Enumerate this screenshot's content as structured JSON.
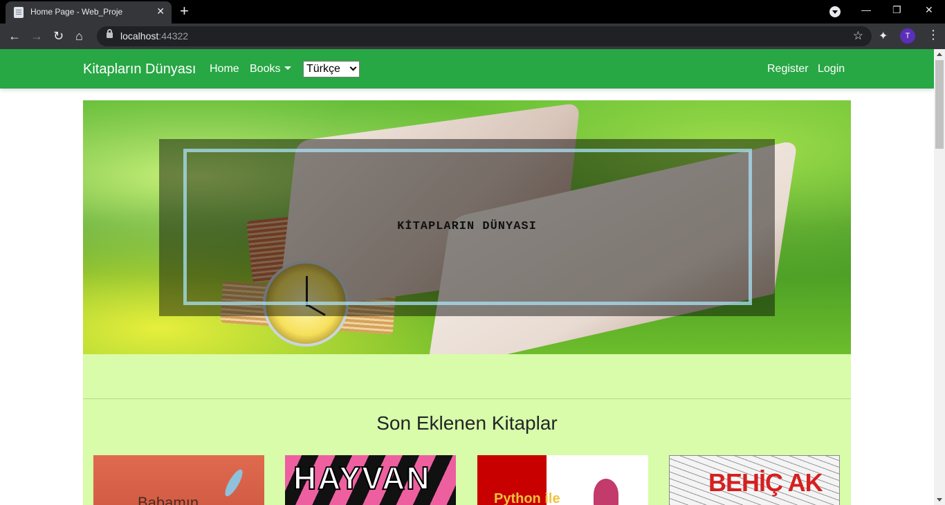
{
  "browser": {
    "tab_title": "Home Page - Web_Proje",
    "tab_close": "✕",
    "new_tab": "+",
    "url_host": "localhost",
    "url_port": ":44322",
    "profile_initial": "T",
    "icons": {
      "back": "arrow-left-icon",
      "forward": "arrow-right-icon",
      "reload": "reload-icon",
      "home": "home-icon",
      "star": "bookmark-star-icon",
      "extensions": "puzzle-icon",
      "menu": "kebab-menu-icon"
    }
  },
  "navbar": {
    "brand": "Kitapların Dünyası",
    "home": "Home",
    "books": "Books",
    "language_selected": "Türkçe",
    "register": "Register",
    "login": "Login",
    "color": "#28a745"
  },
  "hero": {
    "title": "KİTAPLARIN DÜNYASI"
  },
  "section": {
    "title": "Son Eklenen Kitaplar",
    "background": "#d8fca9"
  },
  "books": [
    {
      "cover_text": "Babamın"
    },
    {
      "cover_text": "HAYVAN"
    },
    {
      "cover_text": "Python ile"
    },
    {
      "cover_text": "BEHİÇ AK"
    }
  ]
}
